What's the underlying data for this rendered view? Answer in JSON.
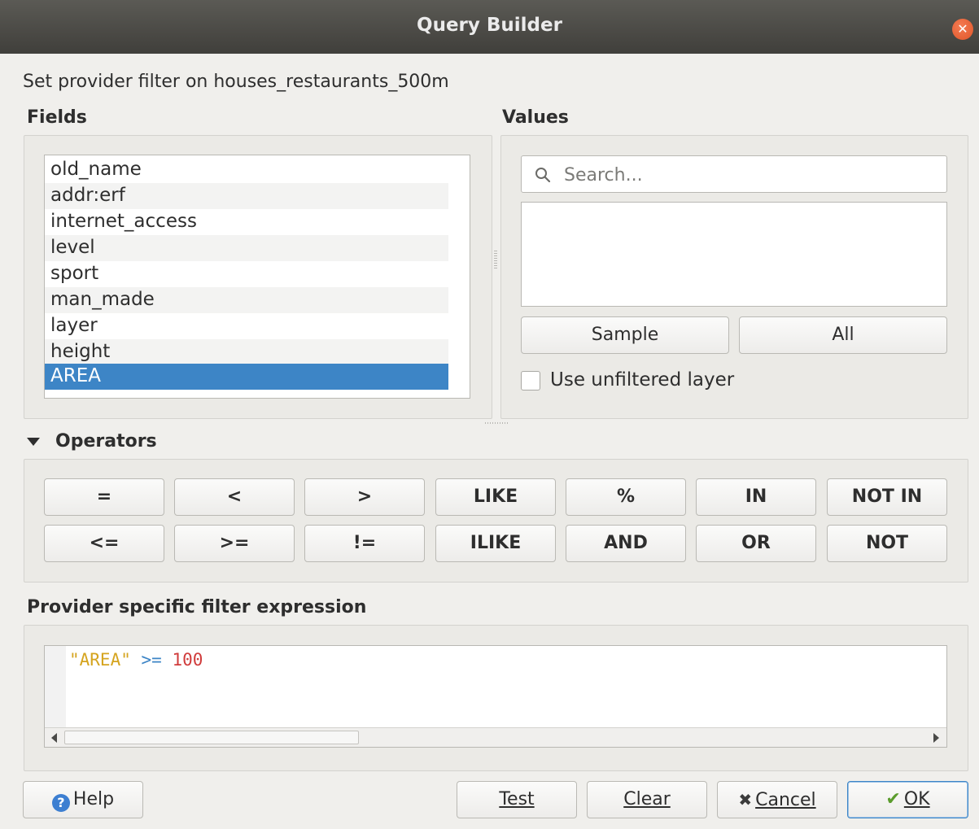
{
  "window": {
    "title": "Query Builder"
  },
  "subtitle": "Set provider filter on houses_restaurants_500m",
  "fields": {
    "label": "Fields",
    "items": [
      "old_name",
      "addr:erf",
      "internet_access",
      "level",
      "sport",
      "man_made",
      "layer",
      "height",
      "AREA"
    ],
    "selected": "AREA"
  },
  "values": {
    "label": "Values",
    "search_placeholder": "Search...",
    "sample_label": "Sample",
    "all_label": "All",
    "unfiltered_label": "Use unfiltered layer",
    "unfiltered_checked": false
  },
  "operators": {
    "label": "Operators",
    "row1": [
      "=",
      "<",
      ">",
      "LIKE",
      "%",
      "IN",
      "NOT IN"
    ],
    "row2": [
      "<=",
      ">=",
      "!=",
      "ILIKE",
      "AND",
      "OR",
      "NOT"
    ]
  },
  "expression": {
    "label": "Provider specific filter expression",
    "field": "\"AREA\"",
    "operator": ">=",
    "value": "100"
  },
  "footer": {
    "help_label": "Help",
    "test_label": "Test",
    "clear_label": "Clear",
    "cancel_label": "Cancel",
    "ok_label": "OK"
  },
  "colors": {
    "selection": "#3d85c6",
    "titlebar": "#4b4a46",
    "close_button": "#e95f33"
  }
}
